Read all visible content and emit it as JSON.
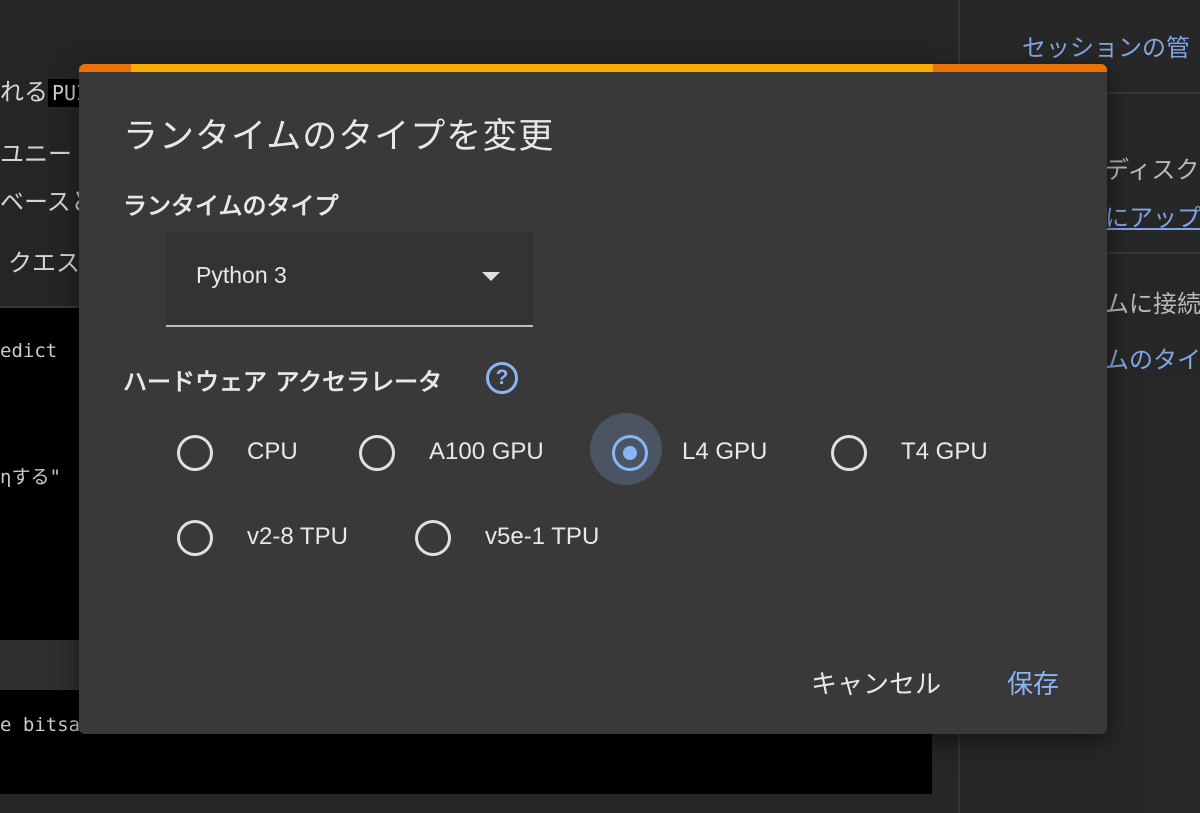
{
  "background": {
    "notebook_text": {
      "line1_prefix": "れる",
      "line1_chip": "PUI",
      "line2": "ユニー",
      "line3": "ベースと",
      "line4": "クエス"
    },
    "code": {
      "line1": "edict",
      "line2": "ηする\"",
      "line3": "e bitsa"
    },
    "right_panel": {
      "session_link": "セッションの管",
      "disk_text": "ディスク",
      "upgrade_link": "にアップ",
      "connect_text": "ムに接続",
      "runtime_link": "ムのタイ"
    }
  },
  "dialog": {
    "title": "ランタイムのタイプを変更",
    "runtime_type_label": "ランタイムのタイプ",
    "runtime_type_value": "Python 3",
    "accelerator_label": "ハードウェア アクセラレータ",
    "help_icon": "?",
    "accelerators": [
      {
        "label": "CPU",
        "checked": false
      },
      {
        "label": "A100 GPU",
        "checked": false
      },
      {
        "label": "L4 GPU",
        "checked": true
      },
      {
        "label": "T4 GPU",
        "checked": false
      },
      {
        "label": "v2-8 TPU",
        "checked": false
      },
      {
        "label": "v5e-1 TPU",
        "checked": false
      }
    ],
    "cancel_label": "キャンセル",
    "save_label": "保存"
  },
  "colors": {
    "accent": "#8ab4f8",
    "progress_track": "#e8710a",
    "progress_fill": "#f9ab00",
    "dialog_bg": "#393939"
  },
  "progress": {
    "fill_fraction": 0.78
  }
}
